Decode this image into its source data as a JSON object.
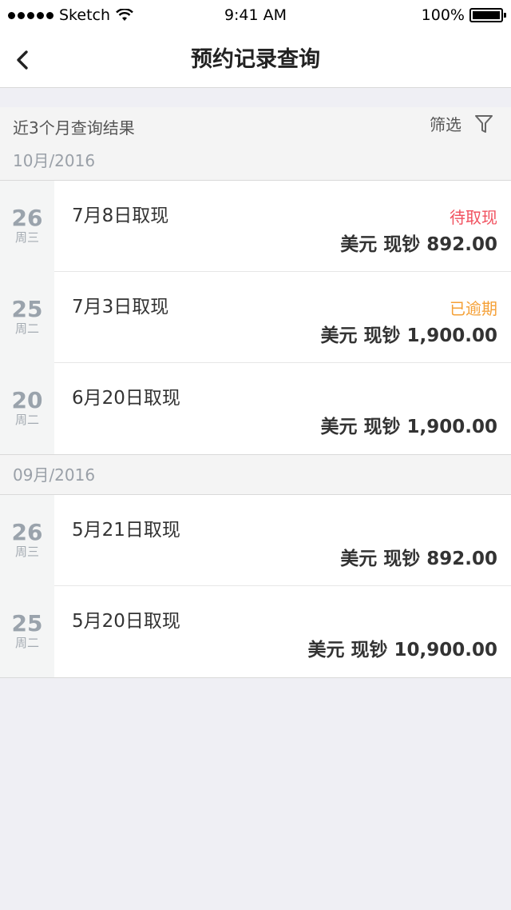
{
  "status_bar": {
    "carrier": "Sketch",
    "time": "9:41 AM",
    "battery": "100%",
    "battery_level": 1.0
  },
  "nav": {
    "title": "预约记录查询",
    "back_icon": "chevron-left-icon"
  },
  "filter": {
    "label": "近3个月查询结果",
    "button": "筛选",
    "icon": "filter-icon"
  },
  "colors": {
    "pending": "#f1515f",
    "overdue": "#f5a036"
  },
  "months": [
    {
      "label": "10月/2016",
      "records": [
        {
          "day": "26",
          "weekday": "周三",
          "title": "7月8日取现",
          "status": "待取现",
          "status_type": "pending",
          "amount": "美元 现钞 892.00"
        },
        {
          "day": "25",
          "weekday": "周二",
          "title": "7月3日取现",
          "status": "已逾期",
          "status_type": "overdue",
          "amount": "美元 现钞 1,900.00"
        },
        {
          "day": "20",
          "weekday": "周二",
          "title": "6月20日取现",
          "status": "",
          "status_type": "",
          "amount": "美元 现钞 1,900.00"
        }
      ]
    },
    {
      "label": "09月/2016",
      "records": [
        {
          "day": "26",
          "weekday": "周三",
          "title": "5月21日取现",
          "status": "",
          "status_type": "",
          "amount": "美元 现钞 892.00"
        },
        {
          "day": "25",
          "weekday": "周二",
          "title": "5月20日取现",
          "status": "",
          "status_type": "",
          "amount": "美元 现钞 10,900.00"
        }
      ]
    }
  ]
}
